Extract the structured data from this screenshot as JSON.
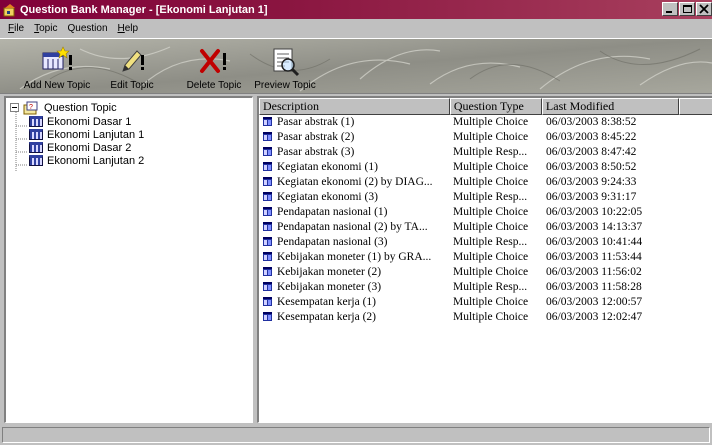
{
  "window": {
    "title": "Question Bank Manager - [Ekonomi Lanjutan 1]",
    "buttons": [
      "minimize-icon",
      "maximize-icon",
      "close-icon"
    ]
  },
  "menu": {
    "file": {
      "u": "F",
      "rest": "ile"
    },
    "topic": {
      "u": "T",
      "rest": "opic"
    },
    "question": {
      "pre": "Question"
    },
    "help": {
      "u": "H",
      "rest": "elp"
    }
  },
  "toolbar": {
    "add_new_topic": "Add New Topic",
    "edit_topic": "Edit Topic",
    "delete_topic": "Delete Topic",
    "preview_topic": "Preview Topic"
  },
  "tree": {
    "root": "Question Topic",
    "items": [
      "Ekonomi Dasar 1",
      "Ekonomi Lanjutan 1",
      "Ekonomi Dasar 2",
      "Ekonomi Lanjutan 2"
    ]
  },
  "list": {
    "columns": [
      "Description",
      "Question Type",
      "Last Modified",
      ""
    ],
    "rows": [
      {
        "description": "Pasar abstrak (1)",
        "type": "Multiple Choice",
        "modified": "06/03/2003 8:38:52"
      },
      {
        "description": "Pasar abstrak (2)",
        "type": "Multiple Choice",
        "modified": "06/03/2003 8:45:22"
      },
      {
        "description": "Pasar abstrak (3)",
        "type": "Multiple Resp...",
        "modified": "06/03/2003 8:47:42"
      },
      {
        "description": "Kegiatan ekonomi (1)",
        "type": "Multiple Choice",
        "modified": "06/03/2003 8:50:52"
      },
      {
        "description": "Kegiatan ekonomi (2) by DIAG...",
        "type": "Multiple Choice",
        "modified": "06/03/2003 9:24:33"
      },
      {
        "description": "Kegiatan ekonomi (3)",
        "type": "Multiple Resp...",
        "modified": "06/03/2003 9:31:17"
      },
      {
        "description": "Pendapatan nasional (1)",
        "type": "Multiple Choice",
        "modified": "06/03/2003 10:22:05"
      },
      {
        "description": "Pendapatan nasional (2) by TA...",
        "type": "Multiple Choice",
        "modified": "06/03/2003 14:13:37"
      },
      {
        "description": "Pendapatan nasional (3)",
        "type": "Multiple Resp...",
        "modified": "06/03/2003 10:41:44"
      },
      {
        "description": "Kebijakan moneter (1) by GRA...",
        "type": "Multiple Choice",
        "modified": "06/03/2003 11:53:44"
      },
      {
        "description": "Kebijakan moneter (2)",
        "type": "Multiple Choice",
        "modified": "06/03/2003 11:56:02"
      },
      {
        "description": "Kebijakan moneter (3)",
        "type": "Multiple Resp...",
        "modified": "06/03/2003 11:58:28"
      },
      {
        "description": "Kesempatan kerja (1)",
        "type": "Multiple Choice",
        "modified": "06/03/2003 12:00:57"
      },
      {
        "description": "Kesempatan kerja (2)",
        "type": "Multiple Choice",
        "modified": "06/03/2003 12:02:47"
      }
    ]
  },
  "colors": {
    "titlebar": "#80003a",
    "face": "#c0c0c0",
    "toolbar_bg": "#9a9a90"
  }
}
